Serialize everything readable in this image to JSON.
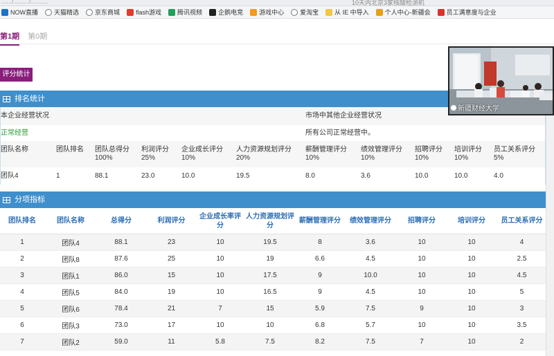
{
  "url_fragment": "....../........./..........",
  "tab_hint": "10天内北京3家核酸检测机",
  "bookmarks": [
    {
      "label": "NOW直播",
      "icon": "now-live-icon",
      "color": "#1b73c8"
    },
    {
      "label": "天猫精选",
      "icon": "globe-icon",
      "color": ""
    },
    {
      "label": "京东商城",
      "icon": "globe-icon",
      "color": ""
    },
    {
      "label": "flash游戏",
      "icon": "flash-game-icon",
      "color": "#e23a2e"
    },
    {
      "label": "腾讯视频",
      "icon": "tencent-video-icon",
      "color": "#20a05a"
    },
    {
      "label": "企鹅电竞",
      "icon": "penguin-esports-icon",
      "color": "#222222"
    },
    {
      "label": "游戏中心",
      "icon": "game-center-icon",
      "color": "#f39a1f"
    },
    {
      "label": "爱淘宝",
      "icon": "globe-icon",
      "color": ""
    },
    {
      "label": "从 IE 中导入",
      "icon": "folder-icon",
      "color": "#f3c742"
    },
    {
      "label": "个人中心-新疆会",
      "icon": "settings-icon",
      "color": "#e8a01a"
    },
    {
      "label": "员工满意度与企业",
      "icon": "bookmark-red-icon",
      "color": "#d9322d"
    }
  ],
  "periods": [
    {
      "label": "第1期",
      "active": true
    },
    {
      "label": "第0期",
      "active": false
    }
  ],
  "score_button": "评分统计",
  "ranking": {
    "title": "排名统计",
    "own_status_label": "本企业经营状况",
    "market_status_label": "市场中其他企业经营状况",
    "own_status_value": "正常经营",
    "market_status_value": "所有公司正常经营中。",
    "headers": [
      {
        "name": "团队名称",
        "weight": ""
      },
      {
        "name": "团队排名",
        "weight": ""
      },
      {
        "name": "团队总得分",
        "weight": "100%"
      },
      {
        "name": "利润评分",
        "weight": "25%"
      },
      {
        "name": "企业成长评分",
        "weight": "10%"
      },
      {
        "name": "人力资源规划评分",
        "weight": "20%"
      },
      {
        "name": "薪酬管理评分",
        "weight": "10%"
      },
      {
        "name": "绩效管理评分",
        "weight": "10%"
      },
      {
        "name": "招聘评分",
        "weight": "10%"
      },
      {
        "name": "培训评分",
        "weight": "10%"
      },
      {
        "name": "员工关系评分",
        "weight": "5%"
      }
    ],
    "row": [
      "团队4",
      "1",
      "88.1",
      "23.0",
      "10.0",
      "19.5",
      "8.0",
      "3.6",
      "10.0",
      "10.0",
      "4.0"
    ]
  },
  "sub_indicators": {
    "title": "分项指标",
    "headers": [
      "团队排名",
      "团队名称",
      "总得分",
      "利润评分",
      "企业成长率评分",
      "人力资源规划评分",
      "薪酬管理评分",
      "绩效管理评分",
      "招聘评分",
      "培训评分",
      "员工关系评分"
    ],
    "rows": [
      [
        "1",
        "团队4",
        "88.1",
        "23",
        "10",
        "19.5",
        "8",
        "3.6",
        "10",
        "10",
        "4"
      ],
      [
        "2",
        "团队8",
        "87.6",
        "25",
        "10",
        "19",
        "6.6",
        "4.5",
        "10",
        "10",
        "2.5"
      ],
      [
        "3",
        "团队1",
        "86.0",
        "15",
        "10",
        "17.5",
        "9",
        "10.0",
        "10",
        "10",
        "4.5"
      ],
      [
        "4",
        "团队5",
        "84.0",
        "19",
        "10",
        "16.5",
        "9",
        "4.5",
        "10",
        "10",
        "5"
      ],
      [
        "5",
        "团队6",
        "78.4",
        "21",
        "7",
        "15",
        "5.9",
        "7.5",
        "9",
        "10",
        "3"
      ],
      [
        "6",
        "团队3",
        "73.0",
        "17",
        "10",
        "10",
        "6.8",
        "5.7",
        "10",
        "10",
        "3.5"
      ],
      [
        "7",
        "团队2",
        "59.0",
        "11",
        "5.8",
        "7.5",
        "8.2",
        "7.5",
        "7",
        "10",
        "2"
      ]
    ]
  },
  "webcam": {
    "caption": "新疆财经大学"
  },
  "colors": {
    "accent": "#8a1f7b",
    "panel_header": "#3f8fcc",
    "table_header_text": "#2c6eb4",
    "status_green": "#2a9b33"
  }
}
